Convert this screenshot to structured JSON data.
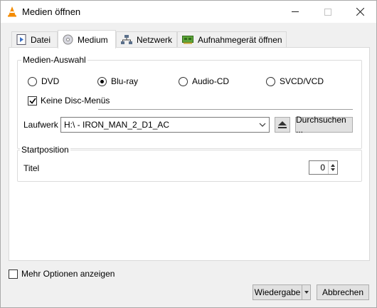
{
  "window": {
    "title": "Medien öffnen"
  },
  "tabs": [
    {
      "label": "Datei",
      "icon": "file-icon"
    },
    {
      "label": "Medium",
      "icon": "disc-icon",
      "active": true
    },
    {
      "label": "Netzwerk",
      "icon": "network-icon"
    },
    {
      "label": "Aufnahmegerät öffnen",
      "icon": "capture-card-icon"
    }
  ],
  "media_selection": {
    "label": "Medien-Auswahl",
    "options": [
      {
        "label": "DVD",
        "checked": false
      },
      {
        "label": "Blu-ray",
        "checked": true
      },
      {
        "label": "Audio-CD",
        "checked": false
      },
      {
        "label": "SVCD/VCD",
        "checked": false
      }
    ],
    "no_disc_menus": {
      "label": "Keine Disc-Menüs",
      "checked": true
    },
    "drive": {
      "label": "Laufwerk",
      "value": "H:\\ - IRON_MAN_2_D1_AC",
      "browse_label": "Durchsuchen ..."
    }
  },
  "start_position": {
    "label": "Startposition",
    "title_label": "Titel",
    "title_value": "0"
  },
  "more_options": {
    "label": "Mehr Optionen anzeigen",
    "checked": false
  },
  "footer": {
    "play_label": "Wiedergabe",
    "cancel_label": "Abbrechen"
  }
}
